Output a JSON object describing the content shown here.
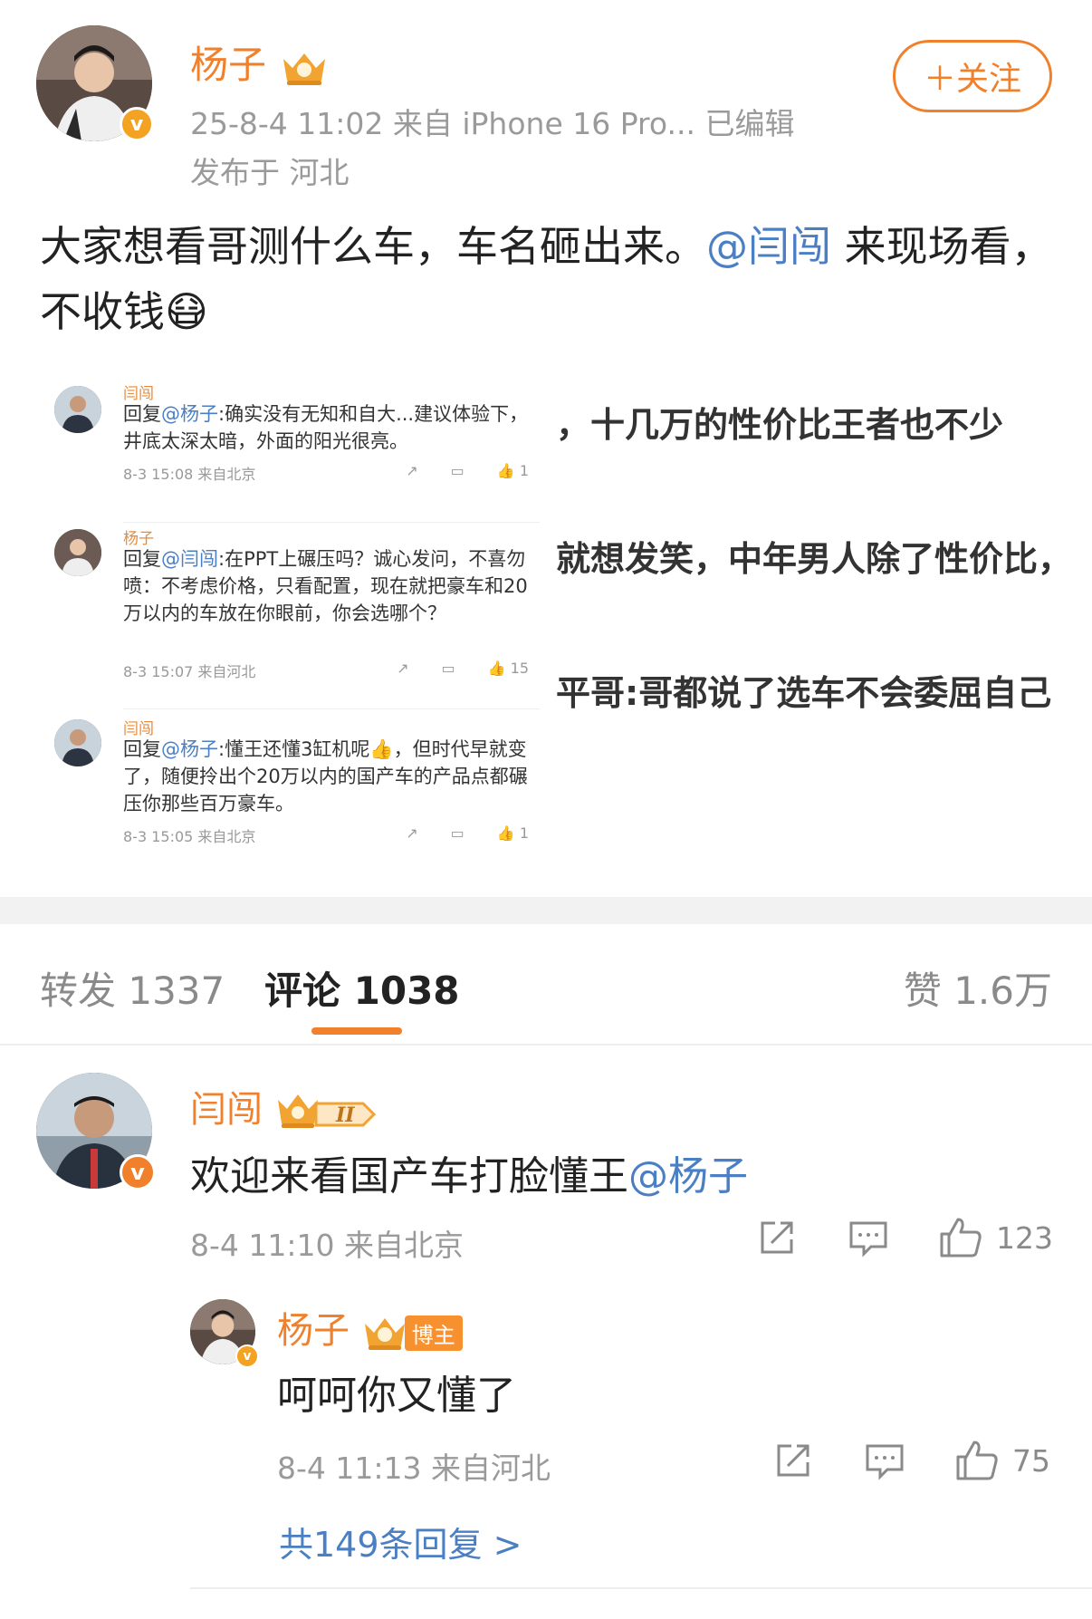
{
  "post": {
    "author": "杨子",
    "meta_line1": "25-8-4 11:02  来自 iPhone 16 Pro...  已编辑",
    "meta_line2": "发布于 河北",
    "follow_label": "＋关注",
    "text_part1": "大家想看哥测什么车，车名砸出来。",
    "mention": "@闫闯",
    "text_part2": " 来现场看，不收钱",
    "emoji": "😷"
  },
  "embed": {
    "right_lines": [
      "，十几万的性价比王者也不少",
      "就想发笑，中年男人除了性价比，",
      "平哥:哥都说了选车不会委屈自己"
    ],
    "right_mention": "平哥",
    "comments": [
      {
        "name": "闫闯",
        "text_prefix": "回复",
        "mention": "@杨子",
        "text": ":确实没有无知和自大...建议体验下，井底太深太暗，外面的阳光很亮。",
        "meta": "8-3 15:08  来自北京",
        "likes": "1"
      },
      {
        "name": "杨子",
        "text_prefix": "回复",
        "mention": "@闫闯",
        "text": ":在PPT上碾压吗？诚心发问，不喜勿喷：不考虑价格，只看配置，现在就把豪车和20万以内的车放在你眼前，你会选哪个？",
        "meta": "8-3 15:07  来自河北",
        "likes": "15"
      },
      {
        "name": "闫闯",
        "text_prefix": "回复",
        "mention": "@杨子",
        "text": ":懂王还懂3缸机呢👍，但时代早就变了，随便拎出个20万以内的国产车的产品点都碾压你那些百万豪车。",
        "meta": "8-3 15:05  来自北京",
        "likes": "1"
      }
    ]
  },
  "tabs": {
    "repost": "转发 1337",
    "comment": "评论 1038",
    "like": "赞 1.6万"
  },
  "comments": [
    {
      "name": "闫闯",
      "text": "欢迎来看国产车打脸懂王",
      "mention": "@杨子",
      "meta": "8-4 11:10  来自北京",
      "likes": "123"
    }
  ],
  "reply": {
    "name": "杨子",
    "badge": "博主",
    "text": "呵呵你又懂了",
    "meta": "8-4 11:13  来自河北",
    "likes": "75"
  },
  "more_replies": "共149条回复 >",
  "colors": {
    "accent": "#f0802c",
    "link": "#4a7fc4",
    "verified": "#f3a221"
  },
  "icons": [
    "crown-badge-icon",
    "verified-v-icon",
    "share-icon",
    "comment-icon",
    "like-icon"
  ]
}
